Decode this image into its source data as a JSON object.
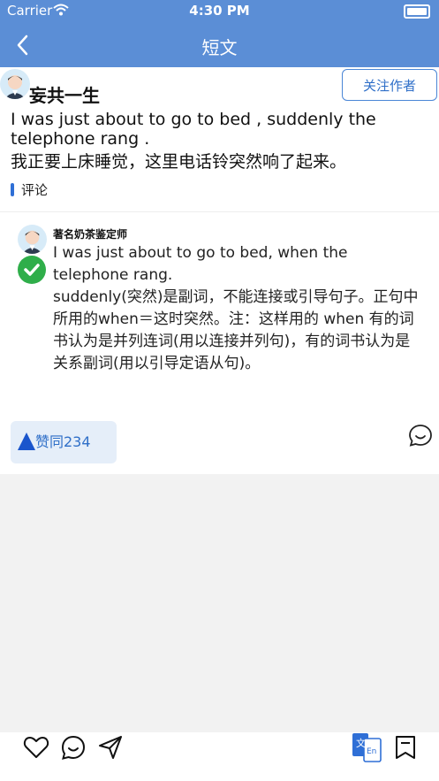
{
  "status_bar": {
    "carrier": "Carrier",
    "time": "4:30 PM"
  },
  "nav": {
    "title": "短文"
  },
  "post": {
    "author": "妄共一生",
    "follow_label": "关注作者",
    "english": "I was just about to go to bed , suddenly the telephone rang .",
    "chinese": "我正要上床睡觉，这里电话铃突然响了起来。"
  },
  "comments": {
    "header": "评论",
    "items": [
      {
        "author": "著名奶茶鉴定师",
        "text": "I was just about to go to bed, when the telephone rang.\nsuddenly(突然)是副词，不能连接或引导句子。正句中所用的when＝这时突然。注：这样用的 when 有的词书认为是并列连词(用以连接并列句)，有的词书认为是关系副词(用以引导定语从句)。",
        "agree_label": "赞同234",
        "accepted": true
      }
    ]
  },
  "colors": {
    "nav_bg": "#5b8ed6",
    "accent": "#2f6fc8",
    "accept_green": "#2fae4a",
    "agree_bg": "#e5eef9"
  },
  "icons": [
    "back-icon",
    "wifi-icon",
    "battery-icon",
    "avatar-icon",
    "check-icon",
    "reply-bubble-icon",
    "heart-icon",
    "comment-icon",
    "share-icon",
    "translate-icon",
    "bookmark-icon"
  ]
}
